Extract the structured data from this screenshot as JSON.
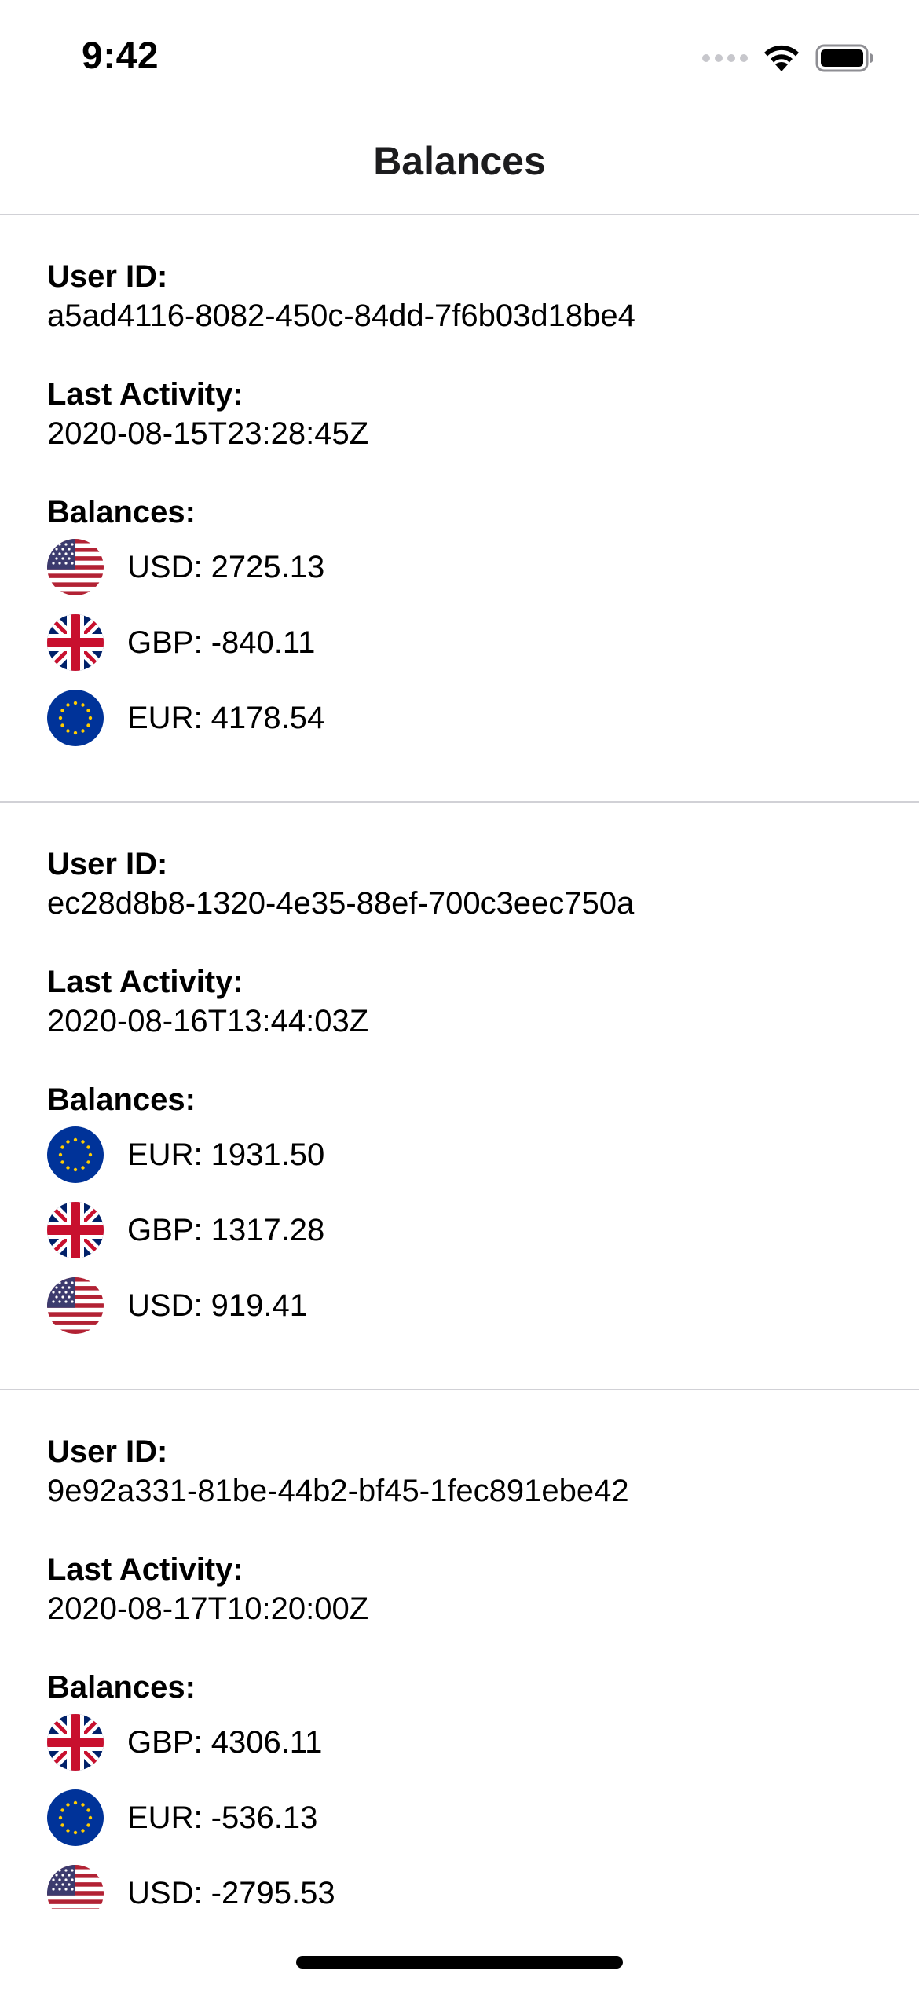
{
  "status_bar": {
    "time": "9:42"
  },
  "nav": {
    "title": "Balances"
  },
  "labels": {
    "user_id": "User ID:",
    "last_activity": "Last Activity:",
    "balances": "Balances:"
  },
  "cards": [
    {
      "user_id": "a5ad4116-8082-450c-84dd-7f6b03d18be4",
      "last_activity": "2020-08-15T23:28:45Z",
      "balances": [
        {
          "currency": "USD",
          "flag": "us-flag-icon",
          "text": "USD: 2725.13"
        },
        {
          "currency": "GBP",
          "flag": "uk-flag-icon",
          "text": "GBP: -840.11"
        },
        {
          "currency": "EUR",
          "flag": "eu-flag-icon",
          "text": "EUR: 4178.54"
        }
      ]
    },
    {
      "user_id": "ec28d8b8-1320-4e35-88ef-700c3eec750a",
      "last_activity": "2020-08-16T13:44:03Z",
      "balances": [
        {
          "currency": "EUR",
          "flag": "eu-flag-icon",
          "text": "EUR: 1931.50"
        },
        {
          "currency": "GBP",
          "flag": "uk-flag-icon",
          "text": "GBP: 1317.28"
        },
        {
          "currency": "USD",
          "flag": "us-flag-icon",
          "text": "USD: 919.41"
        }
      ]
    },
    {
      "user_id": "9e92a331-81be-44b2-bf45-1fec891ebe42",
      "last_activity": "2020-08-17T10:20:00Z",
      "balances": [
        {
          "currency": "GBP",
          "flag": "uk-flag-icon",
          "text": "GBP: 4306.11"
        },
        {
          "currency": "EUR",
          "flag": "eu-flag-icon",
          "text": "EUR: -536.13"
        },
        {
          "currency": "USD",
          "flag": "us-flag-icon",
          "text": "USD: -2795.53"
        }
      ]
    }
  ],
  "colors": {
    "separator": "#d1d1d6",
    "text": "#000000",
    "usd_red": "#b22234",
    "eu_blue": "#003399",
    "eu_star": "#ffcc00",
    "uk_blue": "#012169",
    "uk_red": "#c8102e"
  }
}
